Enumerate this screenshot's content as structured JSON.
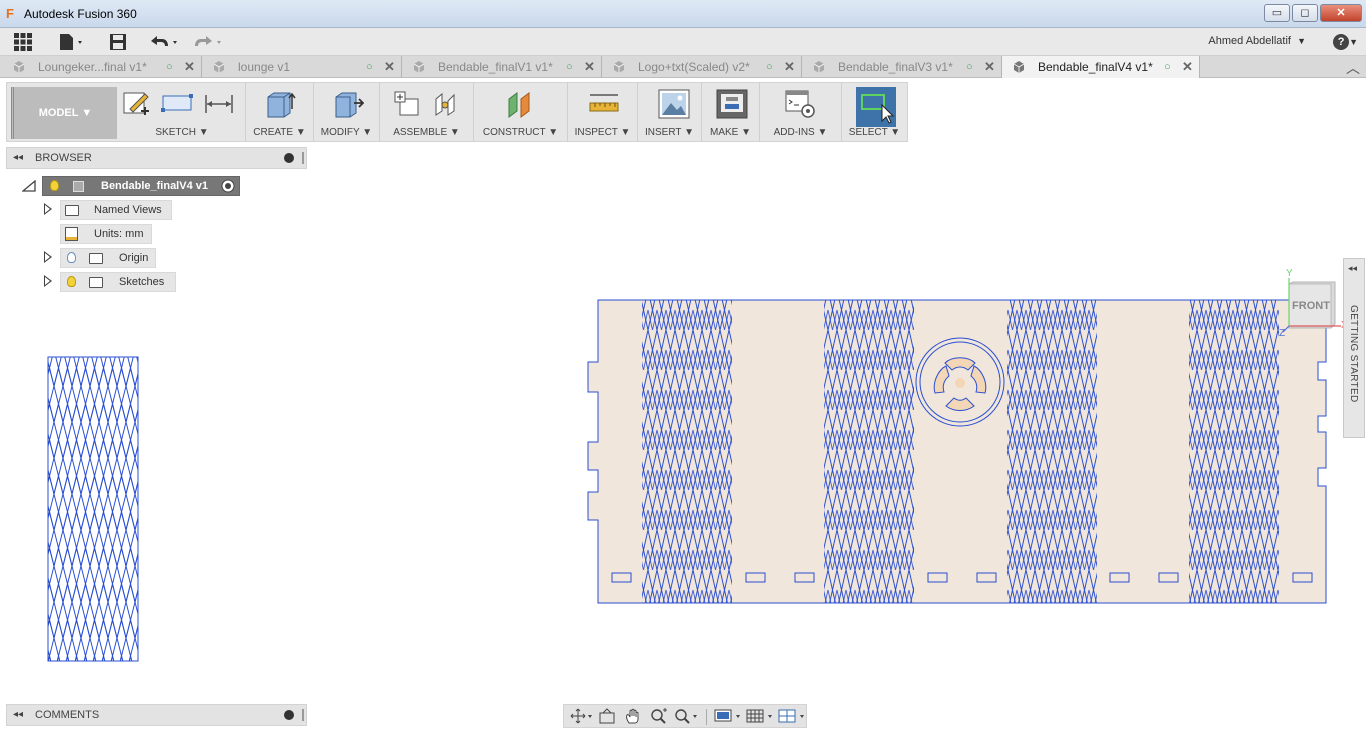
{
  "window": {
    "title": "Autodesk Fusion 360",
    "app_icon": "fusion-logo-icon",
    "logo_letter": "F",
    "controls": {
      "minimize": "▭",
      "maximize": "◻",
      "close": "✕"
    }
  },
  "menubar": {
    "icons": [
      "apps-grid-icon",
      "file-icon",
      "save-icon",
      "undo-icon",
      "redo-icon"
    ],
    "user_name": "Ahmed Abdellatif",
    "user_caret": "▼",
    "help_label": "?",
    "help_caret": "▼"
  },
  "tabs": [
    {
      "label": "Loungeker...final v1*",
      "active": false
    },
    {
      "label": "lounge v1",
      "active": false
    },
    {
      "label": "Bendable_finalV1 v1*",
      "active": false
    },
    {
      "label": "Logo+txt(Scaled) v2*",
      "active": false
    },
    {
      "label": "Bendable_finalV3 v1*",
      "active": false
    },
    {
      "label": "Bendable_finalV4 v1*",
      "active": true
    }
  ],
  "tab_glyphs": {
    "saved": "○",
    "close": "✕",
    "collapse": "︿"
  },
  "toolbar": {
    "workspace": "MODEL ▼",
    "groups": [
      "SKETCH ▼",
      "CREATE ▼",
      "MODIFY ▼",
      "ASSEMBLE ▼",
      "CONSTRUCT ▼",
      "INSPECT ▼",
      "INSERT ▼",
      "MAKE ▼",
      "ADD-INS ▼",
      "SELECT ▼"
    ]
  },
  "browser": {
    "title": "BROWSER",
    "collapse_glyph": "◂◂",
    "root": "Bendable_finalV4 v1",
    "items": [
      {
        "label": "Named Views"
      },
      {
        "label": "Units: mm"
      },
      {
        "label": "Origin"
      },
      {
        "label": "Sketches"
      }
    ]
  },
  "viewcube": {
    "face": "FRONT",
    "axis_y": "Y",
    "axis_x": "X",
    "axis_z": "Z"
  },
  "side_panel": {
    "label": "GETTING STARTED",
    "collapse_glyph": "◂◂"
  },
  "comments": {
    "title": "COMMENTS",
    "collapse_glyph": "◂◂"
  },
  "colors": {
    "sketch_line": "#2a4fd1",
    "panel_fill": "#f0e6db",
    "logo_fill": "#f3d6b5",
    "select_active": "#3d73a8"
  }
}
